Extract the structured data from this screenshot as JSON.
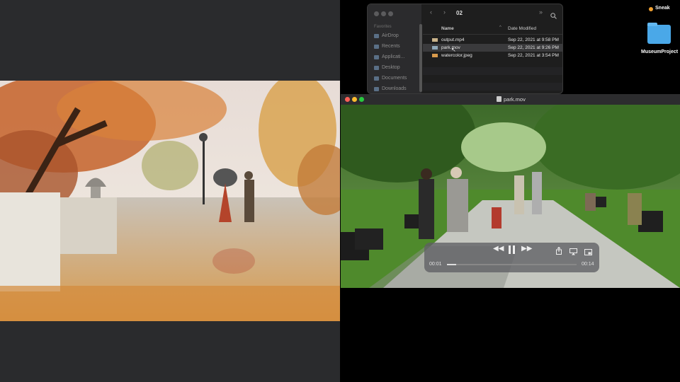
{
  "desktop": {
    "top_item": "Sneak",
    "folder_label": "MuseumProject"
  },
  "finder": {
    "folder_name": "02",
    "sidebar_heading": "Favorites",
    "sidebar_items": [
      "AirDrop",
      "Recents",
      "Applicati...",
      "Desktop",
      "Documents",
      "Downloads"
    ],
    "columns": {
      "name": "Name",
      "date": "Date Modified"
    },
    "files": [
      {
        "name": "output.mp4",
        "date": "Sep 22, 2021 at 9:58 PM",
        "selected": false
      },
      {
        "name": "park.mov",
        "date": "Sep 22, 2021 at 9:26 PM",
        "selected": true
      },
      {
        "name": "watercolor.jpeg",
        "date": "Sep 22, 2021 at 3:54 PM",
        "selected": false
      }
    ]
  },
  "player": {
    "title": "park.mov",
    "elapsed": "00:01",
    "remaining": "00:14",
    "progress": 0.07
  },
  "colors": {
    "selection": "#3a3a3c",
    "folder_blue": "#4aa8e8"
  }
}
